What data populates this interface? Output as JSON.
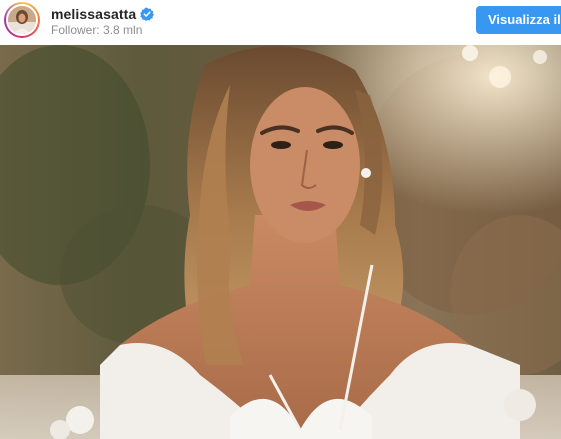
{
  "profile": {
    "username": "melissasatta",
    "verified": true,
    "followers": "Follower: 3.8 mln",
    "avatar_icon": "profile-avatar"
  },
  "actions": {
    "view_profile_label": "Visualizza il profilo"
  },
  "colors": {
    "button": "#3897f0",
    "verified_badge": "#3897f0",
    "username": "#262626",
    "secondary_text": "#8e8e8e"
  },
  "post": {
    "media_icon": "post-photo"
  }
}
